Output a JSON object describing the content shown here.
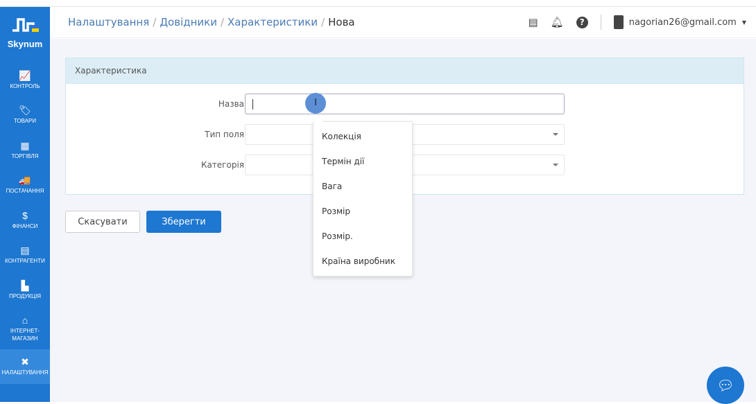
{
  "brand": {
    "name": "Skynum"
  },
  "sidebar": {
    "items": [
      {
        "label": "КОНТРОЛЬ",
        "icon": "chart-icon",
        "glyph": "📈"
      },
      {
        "label": "ТОВАРИ",
        "icon": "tag-icon",
        "glyph": "🏷"
      },
      {
        "label": "ТОРГІВЛЯ",
        "icon": "cash-register-icon",
        "glyph": "▦"
      },
      {
        "label": "ПОСТАЧАННЯ",
        "icon": "truck-icon",
        "glyph": "🚚"
      },
      {
        "label": "ФІНАНСИ",
        "icon": "hand-dollar-icon",
        "glyph": "$"
      },
      {
        "label": "КОНТРАГЕНТИ",
        "icon": "id-card-icon",
        "glyph": "▤"
      },
      {
        "label": "ПРОДУКЦІЯ",
        "icon": "factory-icon",
        "glyph": "▙"
      },
      {
        "label": "ІНТЕРНЕТ-МАГАЗИН",
        "icon": "basket-icon",
        "glyph": "⌂"
      },
      {
        "label": "НАЛАШТУВАННЯ",
        "icon": "tools-icon",
        "glyph": "✖"
      }
    ]
  },
  "header": {
    "breadcrumbs": [
      "Налаштування",
      "Довідники",
      "Характеристики"
    ],
    "current": "Нова",
    "user": "nagorian26@gmail.com"
  },
  "form": {
    "title": "Характеристика",
    "name_label": "Назва",
    "name_value": "",
    "type_label": "Тип поля",
    "category_label": "Категорія"
  },
  "buttons": {
    "cancel": "Скасувати",
    "save": "Зберегти"
  },
  "autocomplete": [
    "Колекція",
    "Термін дії",
    "Вага",
    "Розмір",
    "Розмір.",
    "Країна виробник"
  ],
  "colors": {
    "primary": "#1e77d0"
  }
}
